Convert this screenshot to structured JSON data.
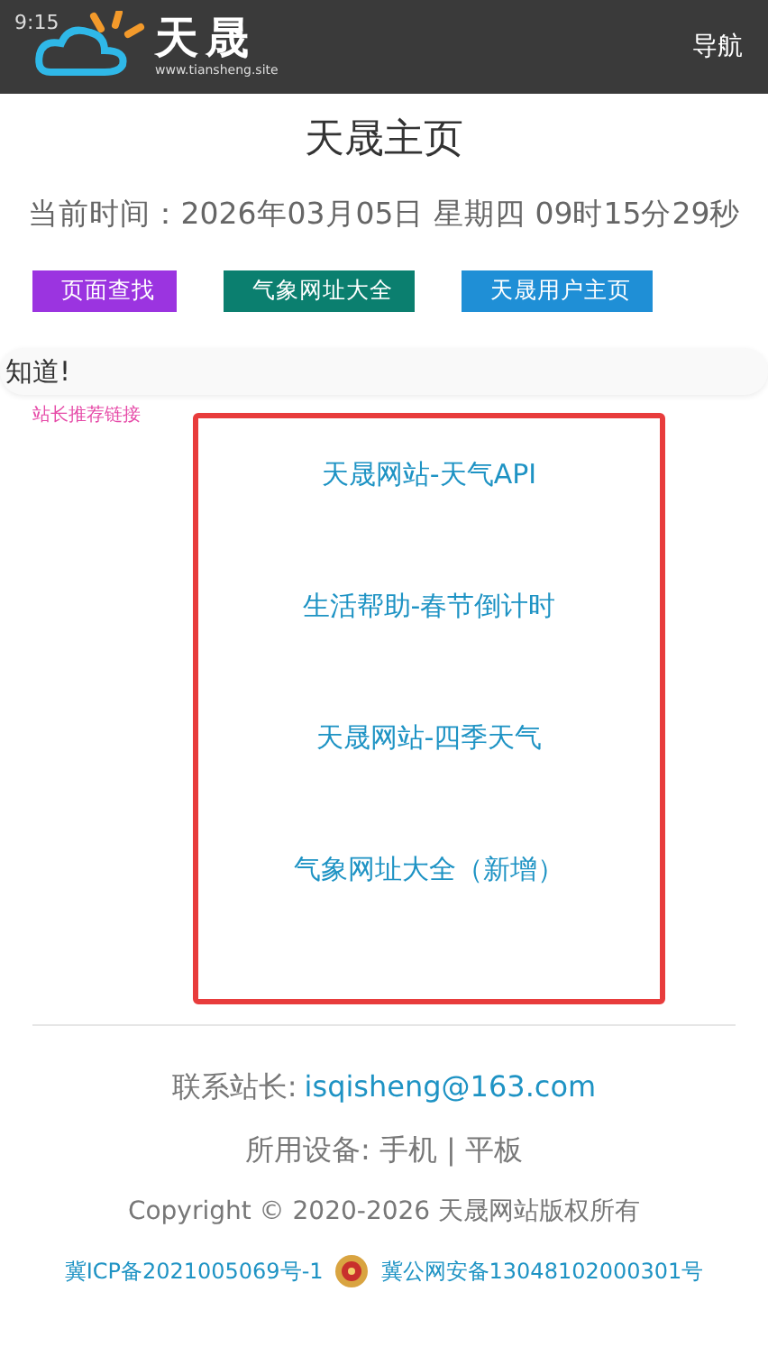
{
  "status_bar": {
    "time": "9:15"
  },
  "header": {
    "logo_name": "天晟",
    "logo_site": "www.tiansheng.site",
    "nav": "导航"
  },
  "title": "天晟主页",
  "clock": "当前时间：2026年03月05日 星期四 09时15分29秒",
  "buttons": [
    {
      "label": "页面查找",
      "color": "#9b34e0"
    },
    {
      "label": "气象网址大全",
      "color": "#0b7f6f"
    },
    {
      "label": "天晟用户主页",
      "color": "#1f8fd6"
    }
  ],
  "marquee": "知道!",
  "recommend_label": "站长推荐链接",
  "links": [
    "天晟网站-天气API",
    "生活帮助-春节倒计时",
    "天晟网站-四季天气",
    "气象网址大全（新增）"
  ],
  "footer": {
    "contact_label": "联系站长:",
    "email": "isqisheng@163.com",
    "devices": "所用设备:  手机 |  平板",
    "copyright": "Copyright © 2020-2026 天晟网站版权所有",
    "icp": "冀ICP备2021005069号-1",
    "police": "冀公网安备13048102000301号"
  }
}
